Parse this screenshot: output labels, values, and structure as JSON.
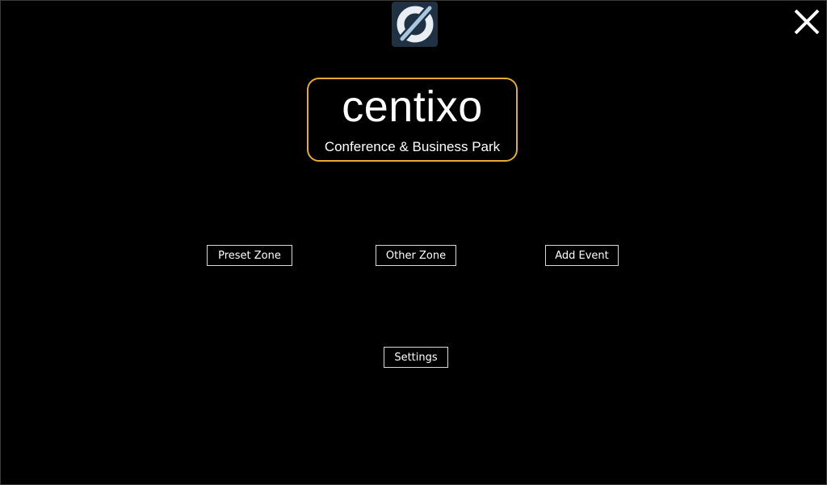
{
  "header": {
    "app_icon": "app-logo-icon",
    "close_icon": "close-icon"
  },
  "brand": {
    "name": "centixo",
    "subtitle": "Conference & Business Park",
    "accent_color": "#e6a936"
  },
  "menu": {
    "preset_zone_label": "Preset Zone",
    "other_zone_label": "Other Zone",
    "add_event_label": "Add Event",
    "settings_label": "Settings"
  },
  "colors": {
    "background": "#000000",
    "icon_tile": "#1f3142",
    "icon_stroke": "#a9c7e0"
  }
}
